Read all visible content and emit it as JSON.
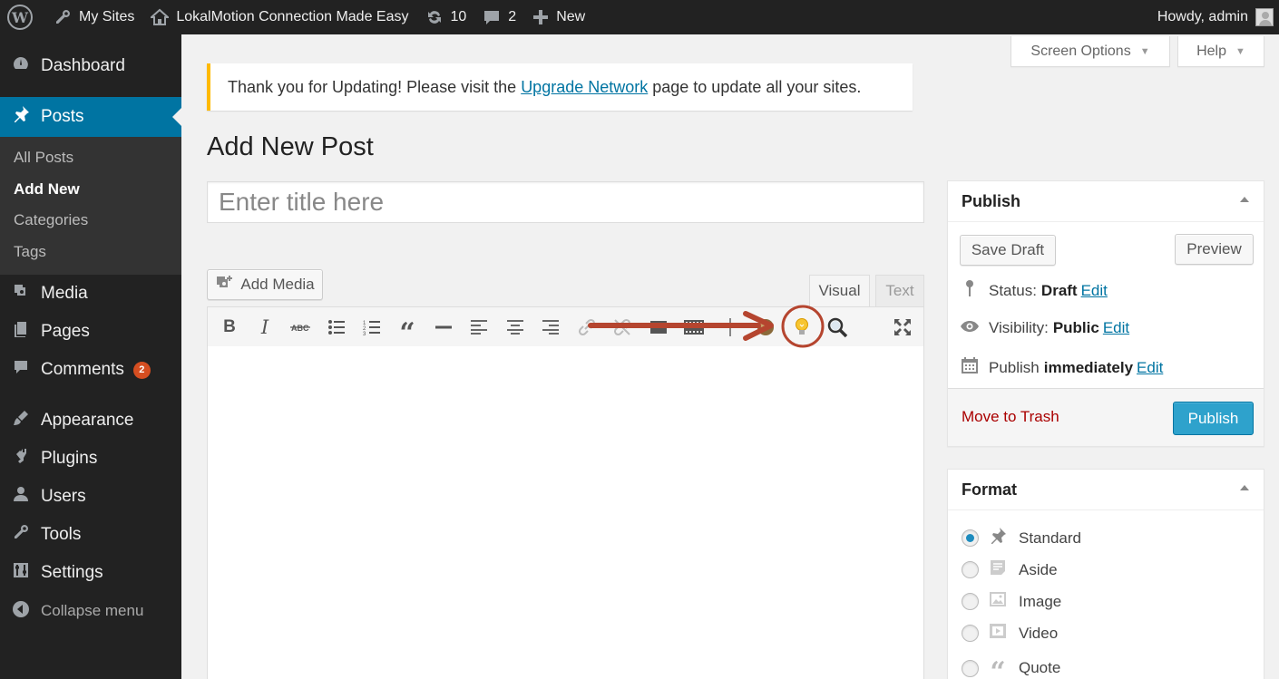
{
  "adminbar": {
    "my_sites": "My Sites",
    "site_name": "LokalMotion Connection Made Easy",
    "updates_count": "10",
    "comments_count": "2",
    "new_label": "New",
    "howdy": "Howdy, admin"
  },
  "sidebar": {
    "dashboard": "Dashboard",
    "posts": "Posts",
    "sub": [
      "All Posts",
      "Add New",
      "Categories",
      "Tags"
    ],
    "media": "Media",
    "pages": "Pages",
    "comments": "Comments",
    "comments_badge": "2",
    "appearance": "Appearance",
    "plugins": "Plugins",
    "users": "Users",
    "tools": "Tools",
    "settings": "Settings",
    "collapse": "Collapse menu"
  },
  "screen_options": "Screen Options",
  "help": "Help",
  "notice": {
    "before": "Thank you for Updating! Please visit the ",
    "link": "Upgrade Network",
    "after": " page to update all your sites."
  },
  "page_title": "Add New Post",
  "title_placeholder": "Enter title here",
  "editor": {
    "add_media": "Add Media",
    "tab_visual": "Visual",
    "tab_text": "Text"
  },
  "publish": {
    "title": "Publish",
    "save_draft": "Save Draft",
    "preview": "Preview",
    "status_label": "Status:",
    "status_value": "Draft",
    "visibility_label": "Visibility:",
    "visibility_value": "Public",
    "publish_label": "Publish",
    "publish_value": "immediately",
    "edit": "Edit",
    "move_to_trash": "Move to Trash",
    "publish_button": "Publish"
  },
  "format": {
    "title": "Format",
    "options": [
      "Standard",
      "Aside",
      "Image",
      "Video",
      "Quote"
    ],
    "selected": "Standard"
  },
  "colors": {
    "adminbar": "#222222",
    "sidebar_active": "#0074a2",
    "primary_button": "#2ea2cc",
    "notice_border": "#ffba00",
    "trash": "#aa0000",
    "annotation": "#b5452f"
  }
}
